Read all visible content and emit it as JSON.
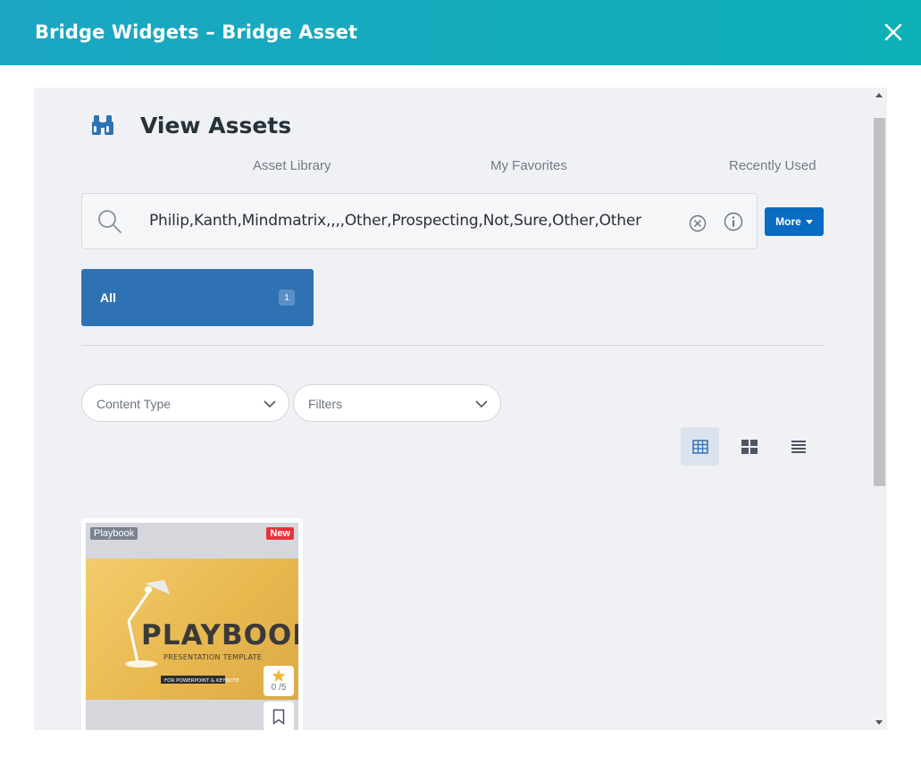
{
  "modal": {
    "title": "Bridge Widgets – Bridge Asset"
  },
  "page": {
    "title": "View Assets"
  },
  "tabs": [
    {
      "label": "Asset Library"
    },
    {
      "label": "My Favorites"
    },
    {
      "label": "Recently Used"
    }
  ],
  "search": {
    "value": "Philip,Kanth,Mindmatrix,,,,Other,Prospecting,Not,Sure,Other,Other"
  },
  "more_button": {
    "label": "More"
  },
  "category": {
    "label": "All",
    "count": "1"
  },
  "filters": {
    "content_type": {
      "label": "Content Type"
    },
    "filters": {
      "label": "Filters"
    }
  },
  "view_modes": [
    "table-view-icon",
    "grid-view-icon",
    "list-view-icon"
  ],
  "assets": [
    {
      "type_badge": "Playbook",
      "new_badge": "New",
      "thumbnail_text": {
        "title": "PLAYBOOK",
        "subtitle": "PRESENTATION TEMPLATE",
        "footer": "FOR POWERPOINT & KEYNOTE"
      },
      "rating": "0 /5"
    }
  ],
  "colors": {
    "header_gradient": "#1aa6c2",
    "accent_blue": "#2f72b4",
    "more_button": "#0a6bc2",
    "new_badge": "#e8333b"
  }
}
